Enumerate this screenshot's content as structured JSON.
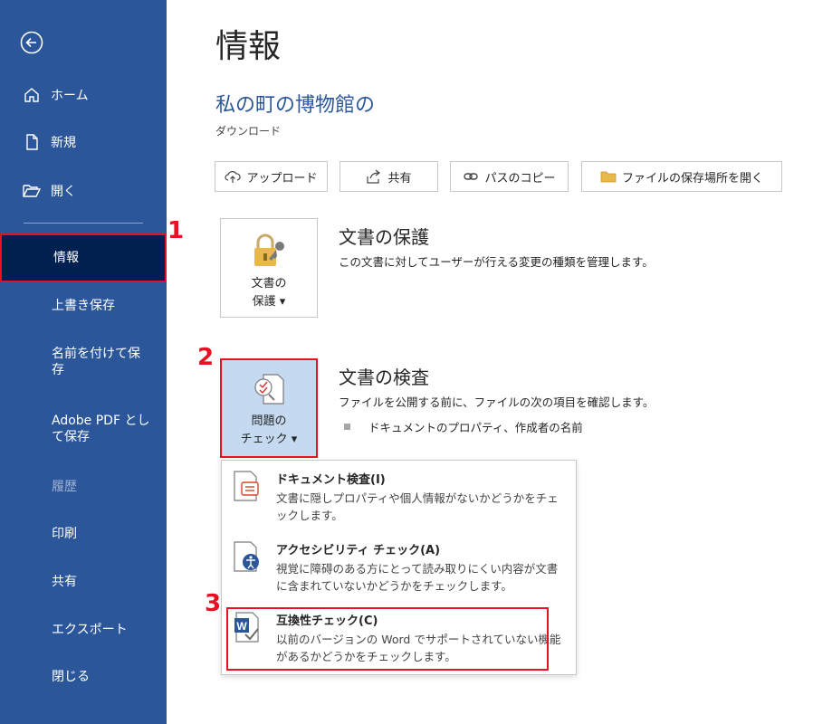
{
  "sidebar": {
    "items": [
      {
        "label": "ホーム",
        "icon": "home-icon"
      },
      {
        "label": "新規",
        "icon": "new-document-icon"
      },
      {
        "label": "開く",
        "icon": "open-folder-icon"
      },
      {
        "label": "情報"
      },
      {
        "label": "上書き保存"
      },
      {
        "label": "名前を付けて保\n存"
      },
      {
        "label": "Adobe PDF とし\nて保存"
      },
      {
        "label": "履歴"
      },
      {
        "label": "印刷"
      },
      {
        "label": "共有"
      },
      {
        "label": "エクスポート"
      },
      {
        "label": "閉じる"
      }
    ]
  },
  "main": {
    "title": "情報",
    "doc_title": "私の町の博物館の",
    "doc_location": "ダウンロード",
    "toolbar": [
      "アップロード",
      "共有",
      "パスのコピー",
      "ファイルの保存場所を開く"
    ]
  },
  "protect": {
    "button_label": "文書の\n保護 ▾",
    "title": "文書の保護",
    "description": "この文書に対してユーザーが行える変更の種類を管理します。"
  },
  "inspect": {
    "button_label": "問題の\nチェック ▾",
    "title": "文書の検査",
    "description": "ファイルを公開する前に、ファイルの次の項目を確認します。",
    "bullet": "ドキュメントのプロパティ、作成者の名前"
  },
  "menu": {
    "items": [
      {
        "title": "ドキュメント検査(I)",
        "description": "文書に隠しプロパティや個人情報がないかどうかをチェックします。"
      },
      {
        "title": "アクセシビリティ チェック(A)",
        "description": "視覚に障碍のある方にとって読み取りにくい内容が文書に含まれていないかどうかをチェックします。"
      },
      {
        "title": "互換性チェック(C)",
        "description": "以前のバージョンの Word でサポートされていない機能があるかどうかをチェックします。"
      }
    ]
  },
  "annotations": [
    "1",
    "2",
    "3"
  ],
  "colors": {
    "sidebar": "#2b579a",
    "active": "#002050",
    "highlight": "#e81123",
    "accent_text": "#2b579a"
  }
}
